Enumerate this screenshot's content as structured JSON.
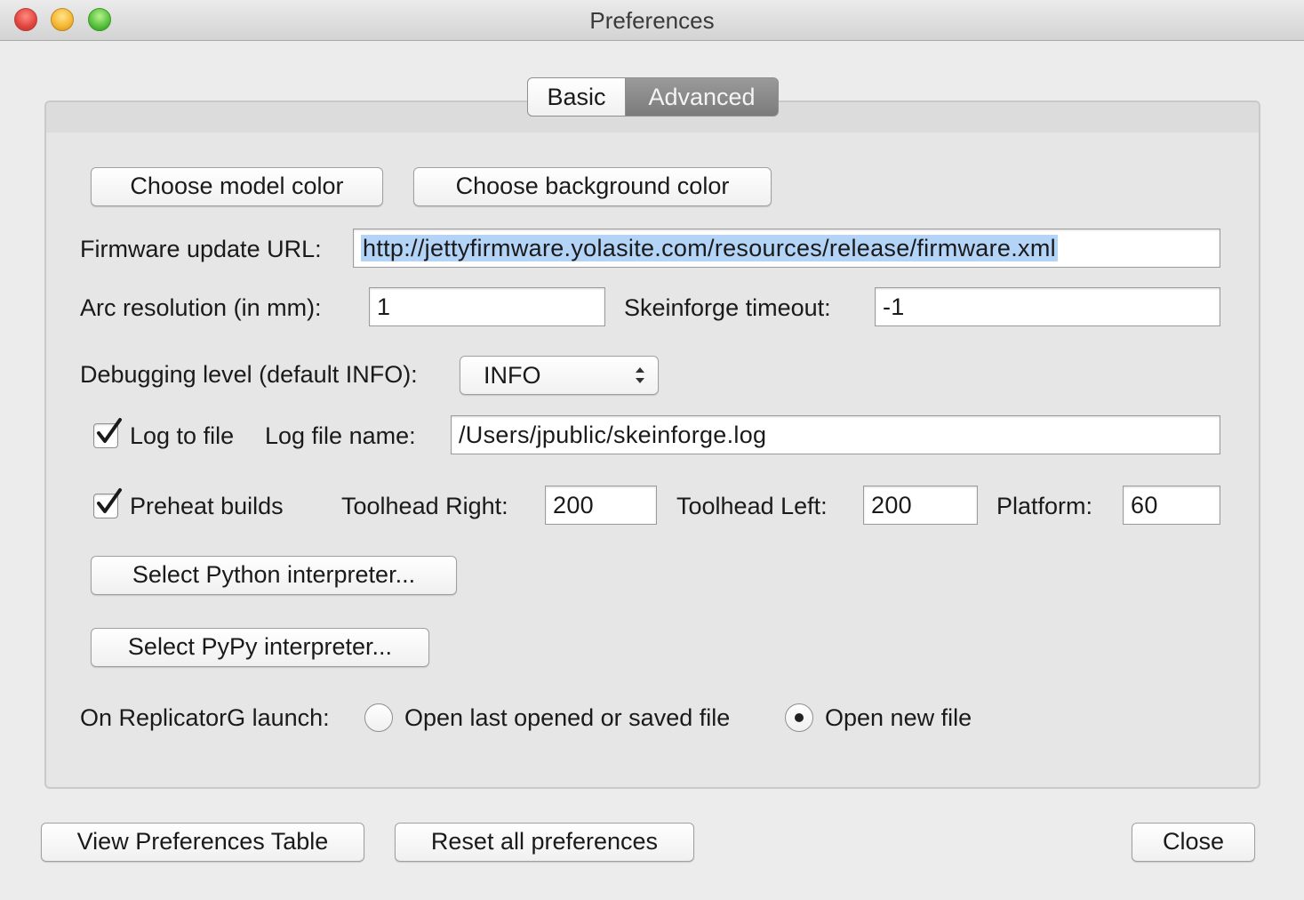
{
  "window": {
    "title": "Preferences"
  },
  "tabs": [
    {
      "label": "Basic",
      "selected": false
    },
    {
      "label": "Advanced",
      "selected": true
    }
  ],
  "advanced": {
    "choose_model_color": "Choose model color",
    "choose_background_color": "Choose background color",
    "firmware_label": "Firmware update URL:",
    "firmware_value": "http://jettyfirmware.yolasite.com/resources/release/firmware.xml",
    "arc_label": "Arc resolution (in mm):",
    "arc_value": "1",
    "skeinforge_label": "Skeinforge timeout:",
    "skeinforge_value": "-1",
    "debug_label": "Debugging level (default INFO):",
    "debug_value": "INFO",
    "log_to_file_label": "Log to file",
    "log_to_file_checked": true,
    "log_file_name_label": "Log file name:",
    "log_file_name_value": "/Users/jpublic/skeinforge.log",
    "preheat_label": "Preheat builds",
    "preheat_checked": true,
    "toolhead_right_label": "Toolhead Right:",
    "toolhead_right_value": "200",
    "toolhead_left_label": "Toolhead Left:",
    "toolhead_left_value": "200",
    "platform_label": "Platform:",
    "platform_value": "60",
    "select_python": "Select Python interpreter...",
    "select_pypy": "Select PyPy interpreter...",
    "launch_label": "On ReplicatorG launch:",
    "launch_options": [
      {
        "label": "Open last opened or saved file",
        "selected": false
      },
      {
        "label": "Open new file",
        "selected": true
      }
    ]
  },
  "footer": {
    "view_table": "View Preferences Table",
    "reset_all": "Reset all preferences",
    "close": "Close"
  }
}
